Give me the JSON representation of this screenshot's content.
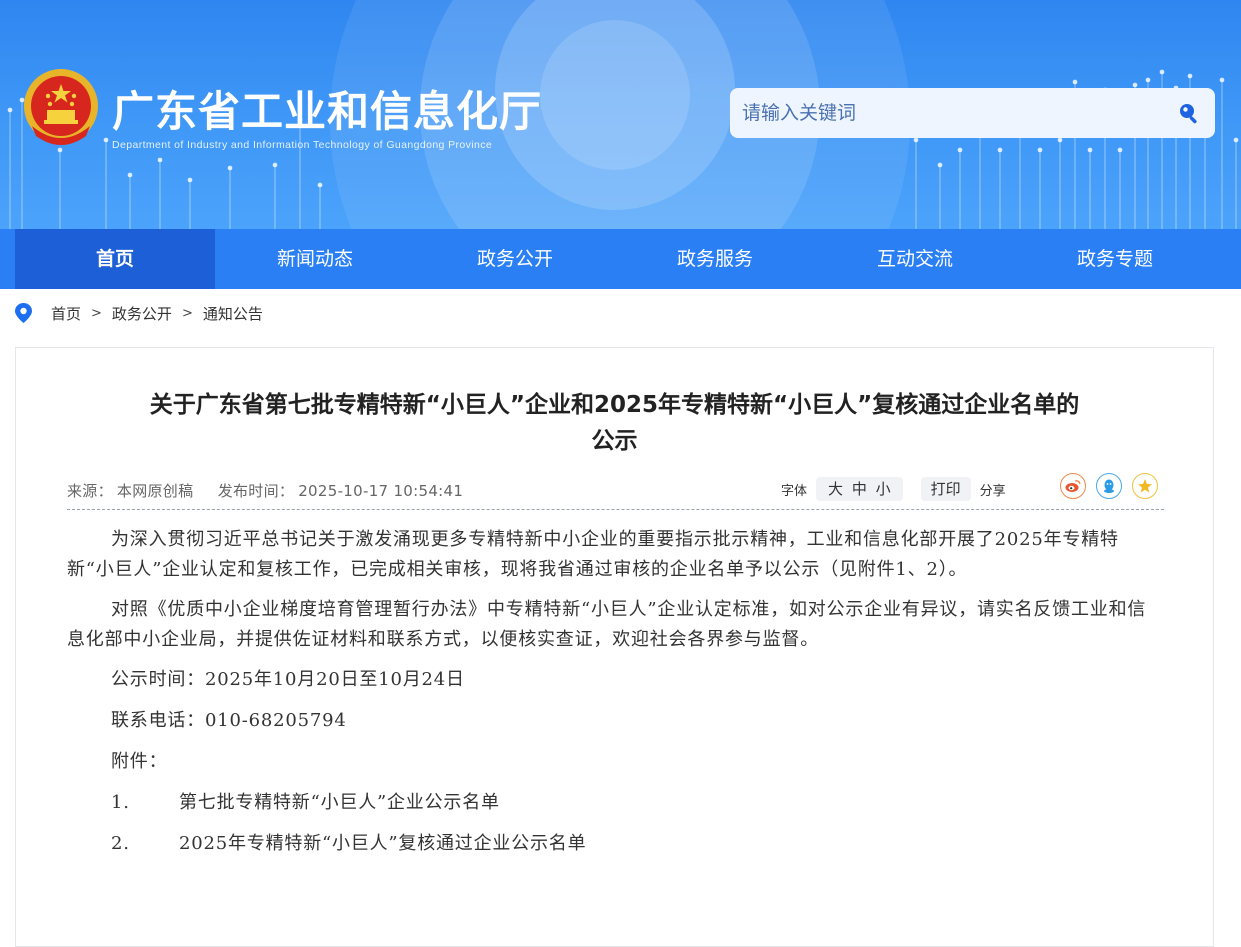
{
  "header": {
    "title": "广东省工业和信息化厅",
    "subtitle": "Department of Industry and Information Technology of Guangdong Province",
    "search_placeholder": "请输入关键词",
    "colors": {
      "header_top": "#2f86f0",
      "nav": "#2a7ff5",
      "nav_active": "#1d5fd6"
    }
  },
  "nav": {
    "items": [
      {
        "label": "首页",
        "active": true
      },
      {
        "label": "新闻动态"
      },
      {
        "label": "政务公开"
      },
      {
        "label": "政务服务"
      },
      {
        "label": "互动交流"
      },
      {
        "label": "政务专题"
      }
    ]
  },
  "breadcrumb": {
    "items": [
      "首页",
      "政务公开",
      "通知公告"
    ],
    "separator": ">"
  },
  "article": {
    "title_line1": "关于广东省第七批专精特新“小巨人”企业和2025年专精特新“小巨人”复核通过企业名单的",
    "title_line2": "公示",
    "source_label": "来源：",
    "source": "本网原创稿",
    "time_label": "发布时间：",
    "time": "2025-10-17 10:54:41",
    "font_label": "字体",
    "font_large": "大",
    "font_medium": "中",
    "font_small": "小",
    "print_label": "打印",
    "share_label": "分享",
    "share_icons": [
      "weibo-icon",
      "qq-icon",
      "qzone-icon"
    ],
    "para1": "为深入贯彻习近平总书记关于激发涌现更多专精特新中小企业的重要指示批示精神，工业和信息化部开展了2025年专精特新“小巨人”企业认定和复核工作，已完成相关审核，现将我省通过审核的企业名单予以公示（见附件1、2）。",
    "para2": "对照《优质中小企业梯度培育管理暂行办法》中专精特新“小巨人”企业认定标准，如对公示企业有异议，请实名反馈工业和信息化部中小企业局，并提供佐证材料和联系方式，以便核实查证，欢迎社会各界参与监督。",
    "period": "公示时间：2025年10月20日至10月24日",
    "phone": "联系电话：010-68205794",
    "attachments_label": "附件：",
    "attachments": [
      {
        "num": "1.",
        "title": "第七批专精特新“小巨人”企业公示名单"
      },
      {
        "num": "2.",
        "title": "2025年专精特新“小巨人”复核通过企业公示名单"
      }
    ]
  }
}
